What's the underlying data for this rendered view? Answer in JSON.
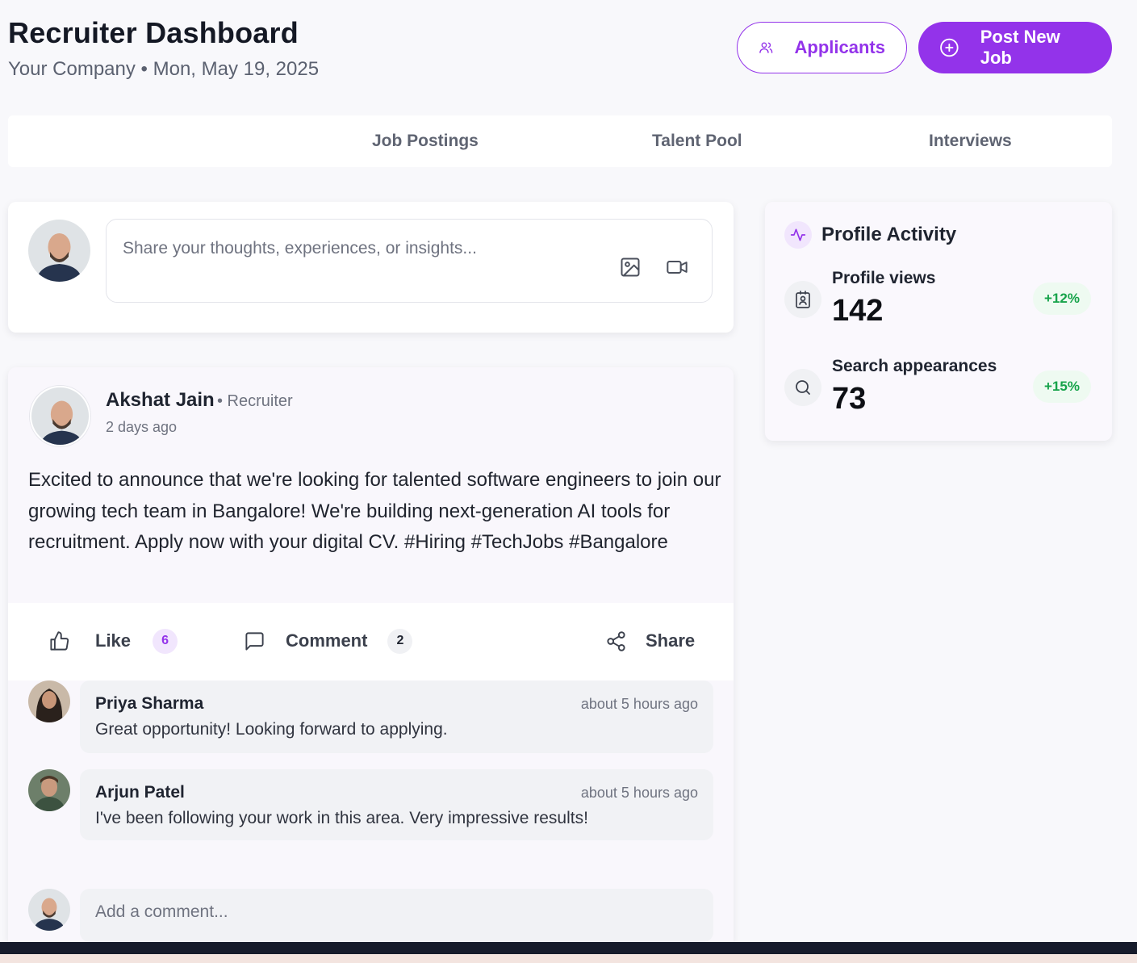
{
  "header": {
    "title": "Recruiter Dashboard",
    "subtitle": "Your Company • Mon, May 19, 2025",
    "applicants_label": "Applicants",
    "post_job_label": "Post New Job"
  },
  "tabs": [
    "Job Postings",
    "Talent Pool",
    "Interviews"
  ],
  "composer": {
    "placeholder": "Share your thoughts, experiences, or insights..."
  },
  "post": {
    "author": "Akshat Jain",
    "role": "• Recruiter",
    "time": "2 days ago",
    "body": "Excited to announce that we're looking for talented software engineers to join our growing tech team in Bangalore! We're building next-generation AI tools for recruitment. Apply now with your digital CV. #Hiring #TechJobs #Bangalore",
    "actions": {
      "like_label": "Like",
      "like_count": "6",
      "comment_label": "Comment",
      "comment_count": "2",
      "share_label": "Share"
    },
    "comments": [
      {
        "author": "Priya Sharma",
        "time": "about 5 hours ago",
        "text": "Great opportunity! Looking forward to applying."
      },
      {
        "author": "Arjun Patel",
        "time": "about 5 hours ago",
        "text": "I've been following your work in this area. Very impressive results!"
      }
    ],
    "add_comment_placeholder": "Add a comment..."
  },
  "activity": {
    "title": "Profile Activity",
    "metrics": [
      {
        "label": "Profile views",
        "value": "142",
        "trend": "+12%",
        "icon": "contact-card-icon"
      },
      {
        "label": "Search appearances",
        "value": "73",
        "trend": "+15%",
        "icon": "search-icon"
      }
    ]
  },
  "colors": {
    "accent": "#9333ea",
    "positive": "#16a34a",
    "background": "#f8f8fb"
  }
}
